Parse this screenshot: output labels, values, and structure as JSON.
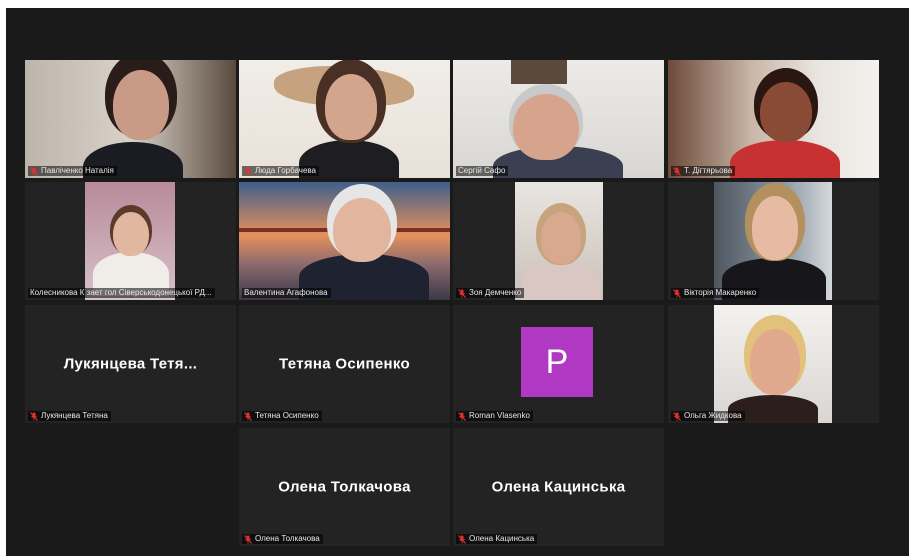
{
  "participants": [
    {
      "name": "Павліченко Наталія"
    },
    {
      "name": "Люда Горбачева"
    },
    {
      "name": "Сергій Сафо"
    },
    {
      "name": "Т. Дігтярьова"
    },
    {
      "name": "Колесникова К зает гол Сіверськодонецької РД..."
    },
    {
      "name": "Валентина Агафонова"
    },
    {
      "name": "Зоя Демченко"
    },
    {
      "name": "Вікторія Макаренко"
    },
    {
      "name": "Лукянцева Тетяна",
      "display": "Лукянцева Тетя..."
    },
    {
      "name": "Тетяна Осипенко",
      "display": "Тетяна Осипенко"
    },
    {
      "name": "Roman Vlasenko",
      "avatar_letter": "P",
      "avatar_color": "#b039c4"
    },
    {
      "name": "Ольга Жидкова"
    },
    {
      "name": "Олена Толкачова",
      "display": "Олена Толкачова"
    },
    {
      "name": "Олена Кацинська",
      "display": "Олена Кацинська"
    }
  ],
  "colors": {
    "background": "#1a1a1a",
    "tile": "#232323",
    "active_speaker": "#c6e24a",
    "muted_mic": "#e0332e"
  }
}
